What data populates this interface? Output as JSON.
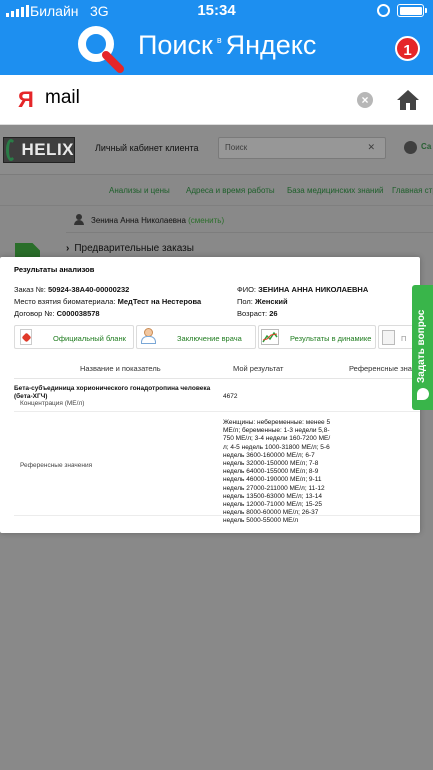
{
  "status_bar": {
    "carrier": "Билайн",
    "network": "3G",
    "time": "15:34"
  },
  "browser": {
    "brand": "Поиск",
    "brand_tiny": "в",
    "brand_name": "Яндекс",
    "notification_count": "1",
    "address_logo": "Я",
    "address_text": "mail",
    "clear_icon": "clear-icon",
    "home_icon": "home-icon"
  },
  "site": {
    "logo_text": "HELIX",
    "cabinet_label": "Личный кабинет клиента",
    "search_placeholder": "Поиск",
    "search_clear": "✕",
    "header_right": "Са",
    "nav": [
      "Анализы и цены",
      "Адреса и время работы",
      "База медицинских знаний",
      "Главная стр"
    ],
    "user_name": "Зенина Анна Николаевна",
    "change_link": "(сменить)",
    "preorders": "Предварительные заказы"
  },
  "results": {
    "title": "Результаты анализов",
    "order_label": "Заказ №:",
    "order_value": "50924-38A40-00000232",
    "place_label": "Место взятия биоматериала:",
    "place_value": "МедТест на Нестерова",
    "contract_label": "Договор №:",
    "contract_value": "C000038578",
    "fio_label": "ФИО:",
    "fio_value": "ЗЕНИНА АННА НИКОЛАЕВНА",
    "sex_label": "Пол:",
    "sex_value": "Женский",
    "age_label": "Возраст:",
    "age_value": "26",
    "buttons": {
      "official": "Официальный бланк",
      "doctor": "Заключение врача",
      "dynamics": "Результаты в динамике",
      "more": "П"
    },
    "table": {
      "col_name": "Название и показатель",
      "col_result": "Мой результат",
      "col_ref": "Референсные значе",
      "test_name": "Бета-субъединица хорионического гонадотропина человека (бета-ХГЧ)",
      "test_metric": "Концентрация (МЕ/л)",
      "test_value": "4672",
      "ref_label": "Референсные значения",
      "ref_text": "Женщины: небеременные: менее 5 МЕ/л; беременные: 1-3 недели 5,8-750 МЕ/л; 3-4 недели 160-7200 МЕ/л; 4-5 недель 1000-31800 МЕ/л; 5-6 недель 3600-160000 МЕ/л; 6-7 недель 32000-150000 МЕ/л; 7-8 недель 64000-155000 МЕ/л; 8-9 недель 46000-190000 МЕ/л; 9-11 недель 27000-211000 МЕ/л; 11-12 недель 13500-63000 МЕ/л; 13-14 недель 12000-71000 МЕ/л; 15-25 недель 8000-60000 МЕ/л; 26-37 недель 5000-55000 МЕ/л"
    }
  },
  "side_tab": {
    "label": "Задать вопрос"
  }
}
